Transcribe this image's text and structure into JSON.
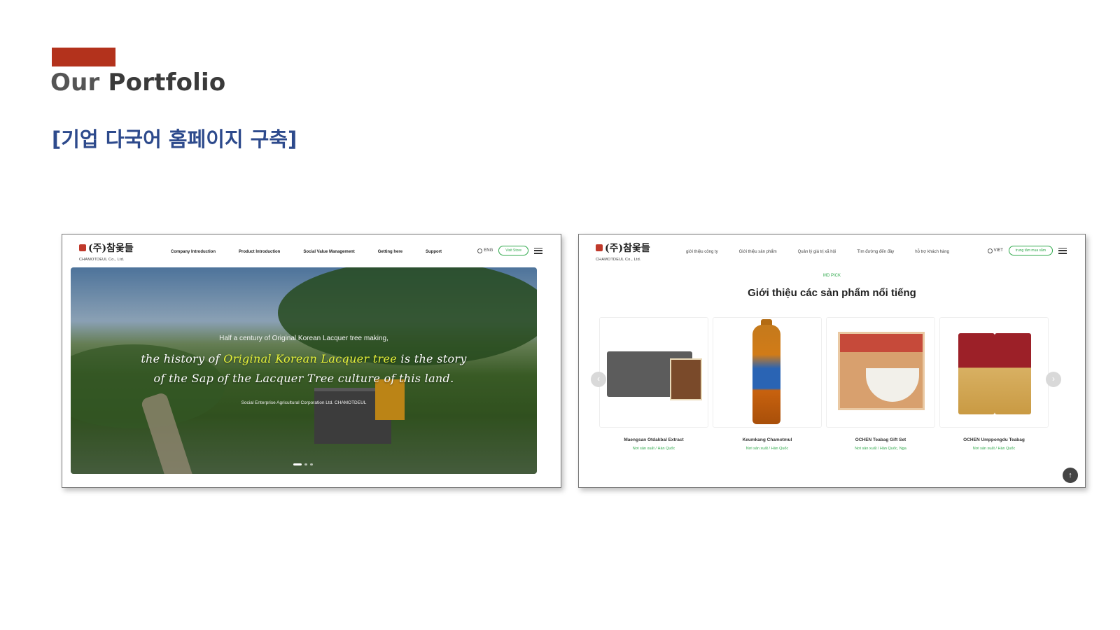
{
  "slide": {
    "title_light": "Our",
    "title_bold": "Portfolio",
    "subtitle": "[기업 다국어 홈페이지 구축]",
    "accent_color": "#b3321c",
    "subtitle_color": "#2d4a8c"
  },
  "english_site": {
    "logo_mark": "(주)참옻들",
    "logo_sub": "CHAMOTDEUL Co., Ltd.",
    "nav": [
      "Company Introduction",
      "Product Introduction",
      "Social Value Management",
      "Getting here",
      "Support"
    ],
    "language": "ENG",
    "store_button": "Visit Store",
    "hero": {
      "small_line": "Half a century of Original Korean Lacquer tree making,",
      "line1_a": "the history of ",
      "line1_highlight": "Original Korean Lacquer tree",
      "line1_b": " is the story",
      "line2": "of the Sap of the Lacquer Tree culture of this land.",
      "caption": "Social Enterprise Agricultural Corporation Ltd. CHAMOTDEUL"
    },
    "icons": [
      "globe-icon",
      "menu-icon"
    ],
    "highlight_color": "#e6f23a"
  },
  "vietnamese_site": {
    "logo_mark": "(주)참옻들",
    "logo_sub": "CHAMOTDEUL Co., Ltd.",
    "nav": [
      "giới thiệu công ty",
      "Giới thiệu sản phẩm",
      "Quản lý giá trị xã hội",
      "Tìm đường đến đây",
      "hỗ trợ khách hàng"
    ],
    "language": "VIET",
    "store_button": "trung tâm mua sắm",
    "md_pick": "MD PICK",
    "section_title": "Giới thiệu các sản phẩm nổi tiếng",
    "products": [
      {
        "name": "Maengsan Otdakbal Extract",
        "origin": "Nơi sản xuất / Hàn Quốc"
      },
      {
        "name": "Keumkang Chamotmul",
        "origin": "Nơi sản xuất / Hàn Quốc"
      },
      {
        "name": "OCHEN Teabag Gift Set",
        "origin": "Nơi sản xuất / Hàn Quốc, Nga"
      },
      {
        "name": "OCHEN Umppongdu Teabag",
        "origin": "Nơi sản xuất / Hàn Quốc"
      }
    ],
    "arrows": {
      "prev": "‹",
      "next": "›"
    },
    "to_top": "↑",
    "icons": [
      "globe-icon",
      "menu-icon",
      "arrow-up-icon"
    ],
    "green_color": "#2ea84a"
  }
}
